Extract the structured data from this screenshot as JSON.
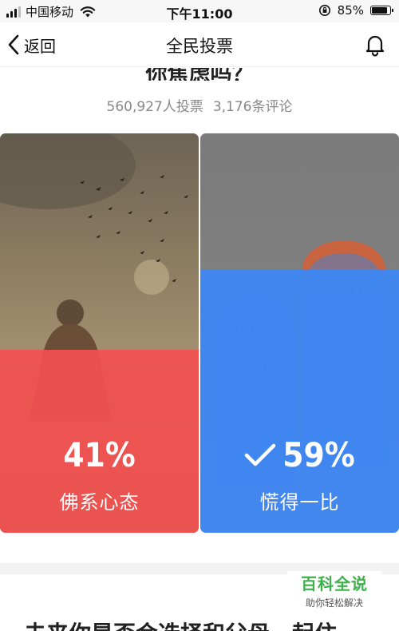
{
  "status_bar": {
    "carrier": "中国移动",
    "time": "下午11:00",
    "battery": "85%",
    "battery_level": 0.85,
    "icons": [
      "signal-icon",
      "wifi-icon",
      "rotation-lock-icon",
      "battery-icon"
    ]
  },
  "nav": {
    "back_label": "返回",
    "title": "全民投票",
    "icons": [
      "chevron-left-icon",
      "bell-icon"
    ]
  },
  "question": {
    "text": "你焦虑吗？",
    "vote_count": "560,927人投票",
    "comment_count": "3,176条评论"
  },
  "options": [
    {
      "percent": "41%",
      "share": 0.41,
      "label": "佛系心态",
      "color": "#f25050",
      "selected": false
    },
    {
      "percent": "59%",
      "share": 0.59,
      "label": "慌得一比",
      "color": "#3c87f5",
      "selected": true,
      "icon": "checkmark-icon"
    }
  ],
  "next_question": "未来你是否会选择和父母一起住",
  "watermark": {
    "title": "百科全说",
    "subtitle": "助你轻松解决"
  }
}
